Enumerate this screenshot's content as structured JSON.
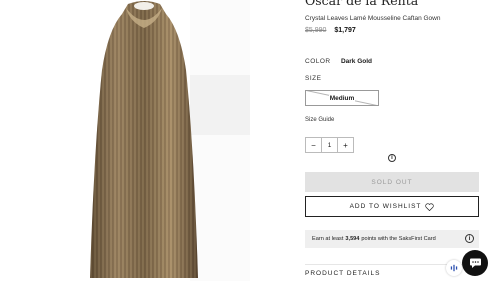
{
  "product": {
    "brand": "Oscar de la Renta",
    "name": "Crystal Leaves Lamé Mousseline Caftan Gown",
    "price_original": "$5,990",
    "price_sale": "$1,797"
  },
  "color": {
    "label": "COLOR",
    "value": "Dark Gold"
  },
  "size": {
    "label": "SIZE",
    "options": [
      "Medium"
    ],
    "guide_label": "Size Guide"
  },
  "quantity": {
    "minus": "−",
    "value": "1",
    "plus": "+"
  },
  "info_icon": "i",
  "buttons": {
    "sold_out": "SOLD OUT",
    "wishlist": "ADD TO WISHLIST"
  },
  "promo": {
    "prefix": "Earn at least",
    "points": "3,594",
    "suffix": "points with the SaksFirst Card",
    "info_icon": "i"
  },
  "details": {
    "label": "PRODUCT DETAILS"
  },
  "colors": {
    "gold": "#8a7350",
    "dark": "#111111",
    "soldout_bg": "#e2e2e2"
  }
}
